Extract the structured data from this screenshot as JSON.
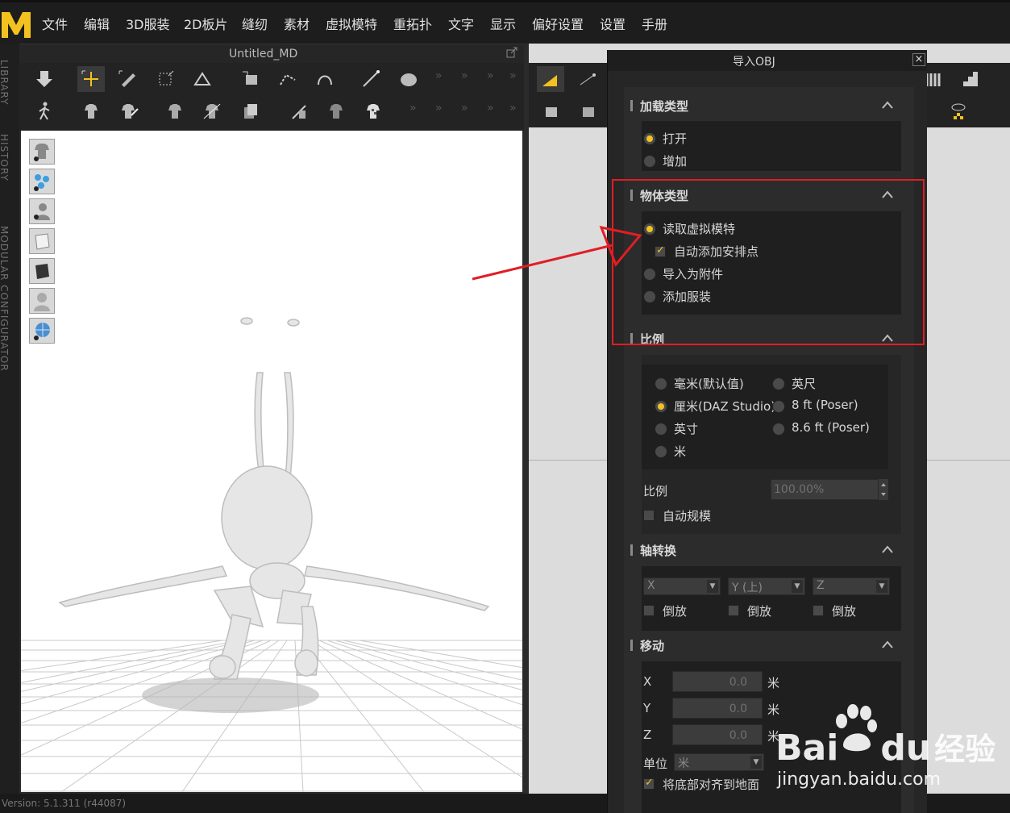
{
  "menu": [
    "文件",
    "编辑",
    "3D服装",
    "2D板片",
    "缝纫",
    "素材",
    "虚拟模特",
    "重拓扑",
    "文字",
    "显示",
    "偏好设置",
    "设置",
    "手册"
  ],
  "side_tabs": [
    "LIBRARY",
    "HISTORY",
    "MODULAR CONFIGURATOR"
  ],
  "panel3d": {
    "title": "Untitled_MD"
  },
  "dialog": {
    "title": "导入OBJ",
    "close": "×",
    "load_type": {
      "title": "加载类型",
      "options": [
        "打开",
        "增加"
      ],
      "selected": 0
    },
    "object_type": {
      "title": "物体类型",
      "options": [
        "读取虚拟模特",
        "导入为附件",
        "添加服装"
      ],
      "selected": 0,
      "auto_arrange": "自动添加安排点"
    },
    "scale": {
      "title": "比例",
      "left_options": [
        "毫米(默认值)",
        "厘米(DAZ Studio)",
        "英寸",
        "米"
      ],
      "right_options": [
        "英尺",
        "8 ft (Poser)",
        "8.6 ft (Poser)"
      ],
      "selected": "厘米(DAZ Studio)",
      "ratio_label": "比例",
      "ratio_value": "100.00%",
      "auto_scale": "自动规模"
    },
    "axis": {
      "title": "轴转换",
      "selects": [
        "X",
        "Y (上)",
        "Z"
      ],
      "invert": "倒放"
    },
    "move": {
      "title": "移动",
      "axes": [
        "X",
        "Y",
        "Z"
      ],
      "values": [
        "0.0",
        "0.0",
        "0.0"
      ],
      "unit": "米",
      "unit_label": "单位",
      "unit_value": "米",
      "align_floor": "将底部对齐到地面"
    }
  },
  "status": {
    "version": "Version: 5.1.311 (r44087)"
  },
  "watermark": {
    "brand_a": "Bai",
    "brand_b": "du",
    "brand_c": "经验",
    "url": "jingyan.baidu.com"
  },
  "colors": {
    "accent": "#f3c21f",
    "annotation": "#e01e24",
    "bg_dark": "#1d1d1d"
  }
}
